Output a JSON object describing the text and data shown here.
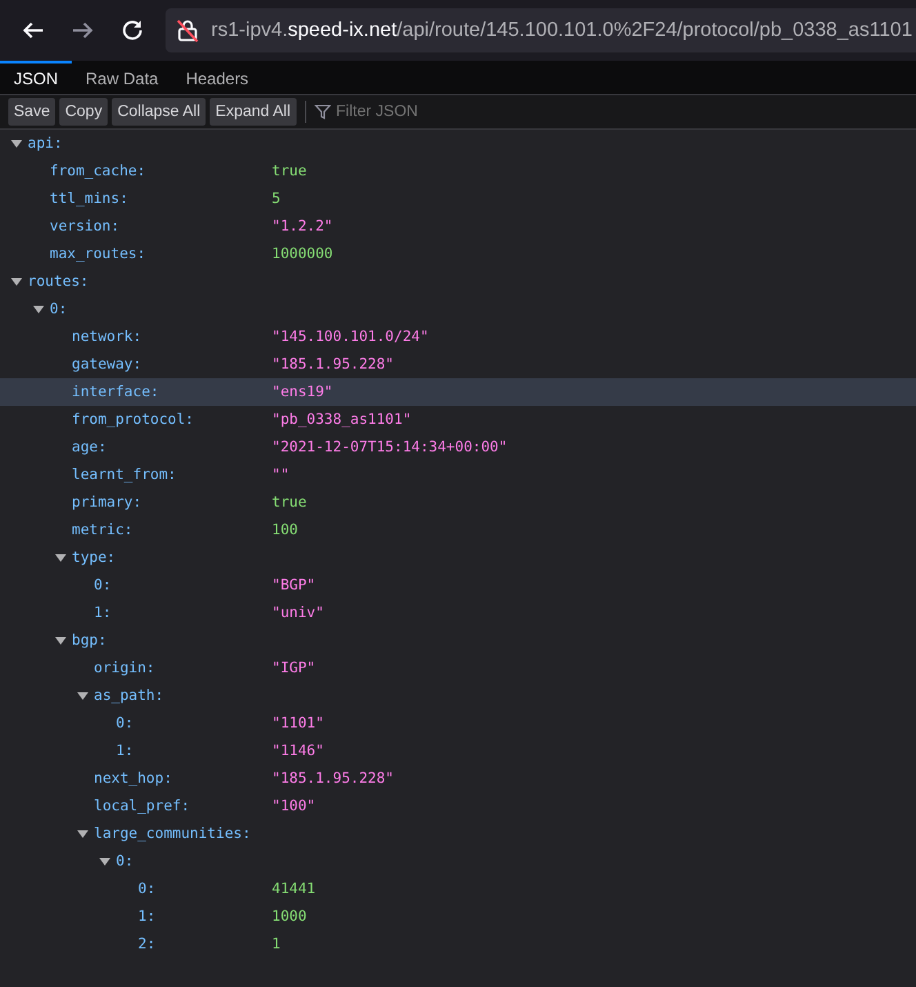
{
  "address_bar": {
    "url": "rs1-ipv4.**speed-ix.net**/api/route/145.100.101.0%2F24/protocol/pb_0338_as1101"
  },
  "tabs": [
    {
      "label": "JSON",
      "selected": true
    },
    {
      "label": "Raw Data",
      "selected": false
    },
    {
      "label": "Headers",
      "selected": false
    }
  ],
  "toolbar": {
    "buttons": [
      "Save",
      "Copy",
      "Collapse All",
      "Expand All"
    ],
    "filter": {
      "placeholder": "Filter JSON"
    }
  },
  "tree": [
    {
      "key": "api:",
      "expanded": true,
      "selected": false,
      "children": [
        {
          "key": "from_cache:",
          "value": "true",
          "kind": "literal",
          "selected": false
        },
        {
          "key": "ttl_mins:",
          "value": "5",
          "kind": "literal",
          "selected": false
        },
        {
          "key": "version:",
          "value": "\"1.2.2\"",
          "kind": "string",
          "selected": false
        },
        {
          "key": "max_routes:",
          "value": "1000000",
          "kind": "literal",
          "selected": false
        }
      ]
    },
    {
      "key": "routes:",
      "expanded": true,
      "selected": false,
      "children": [
        {
          "key": "0:",
          "expanded": true,
          "selected": false,
          "children": [
            {
              "key": "network:",
              "value": "\"145.100.101.0/24\"",
              "kind": "string",
              "selected": false
            },
            {
              "key": "gateway:",
              "value": "\"185.1.95.228\"",
              "kind": "string",
              "selected": false
            },
            {
              "key": "interface:",
              "value": "\"ens19\"",
              "kind": "string",
              "selected": true
            },
            {
              "key": "from_protocol:",
              "value": "\"pb_0338_as1101\"",
              "kind": "string",
              "selected": false
            },
            {
              "key": "age:",
              "value": "\"2021-12-07T15:14:34+00:00\"",
              "kind": "string",
              "selected": false
            },
            {
              "key": "learnt_from:",
              "value": "\"\"",
              "kind": "string",
              "selected": false
            },
            {
              "key": "primary:",
              "value": "true",
              "kind": "literal",
              "selected": false
            },
            {
              "key": "metric:",
              "value": "100",
              "kind": "literal",
              "selected": false
            },
            {
              "key": "type:",
              "expanded": true,
              "selected": false,
              "children": [
                {
                  "key": "0:",
                  "value": "\"BGP\"",
                  "kind": "string",
                  "selected": false
                },
                {
                  "key": "1:",
                  "value": "\"univ\"",
                  "kind": "string",
                  "selected": false
                }
              ]
            },
            {
              "key": "bgp:",
              "expanded": true,
              "selected": false,
              "children": [
                {
                  "key": "origin:",
                  "value": "\"IGP\"",
                  "kind": "string",
                  "selected": false
                },
                {
                  "key": "as_path:",
                  "expanded": true,
                  "selected": false,
                  "children": [
                    {
                      "key": "0:",
                      "value": "\"1101\"",
                      "kind": "string",
                      "selected": false
                    },
                    {
                      "key": "1:",
                      "value": "\"1146\"",
                      "kind": "string",
                      "selected": false
                    }
                  ]
                },
                {
                  "key": "next_hop:",
                  "value": "\"185.1.95.228\"",
                  "kind": "string",
                  "selected": false
                },
                {
                  "key": "local_pref:",
                  "value": "\"100\"",
                  "kind": "string",
                  "selected": false
                },
                {
                  "key": "large_communities:",
                  "expanded": true,
                  "selected": false,
                  "children": [
                    {
                      "key": "0:",
                      "expanded": true,
                      "selected": false,
                      "children": [
                        {
                          "key": "0:",
                          "value": "41441",
                          "kind": "literal",
                          "selected": false
                        },
                        {
                          "key": "1:",
                          "value": "1000",
                          "kind": "literal",
                          "selected": false
                        },
                        {
                          "key": "2:",
                          "value": "1",
                          "kind": "literal",
                          "selected": false
                        }
                      ]
                    }
                  ]
                }
              ]
            }
          ]
        }
      ]
    }
  ]
}
